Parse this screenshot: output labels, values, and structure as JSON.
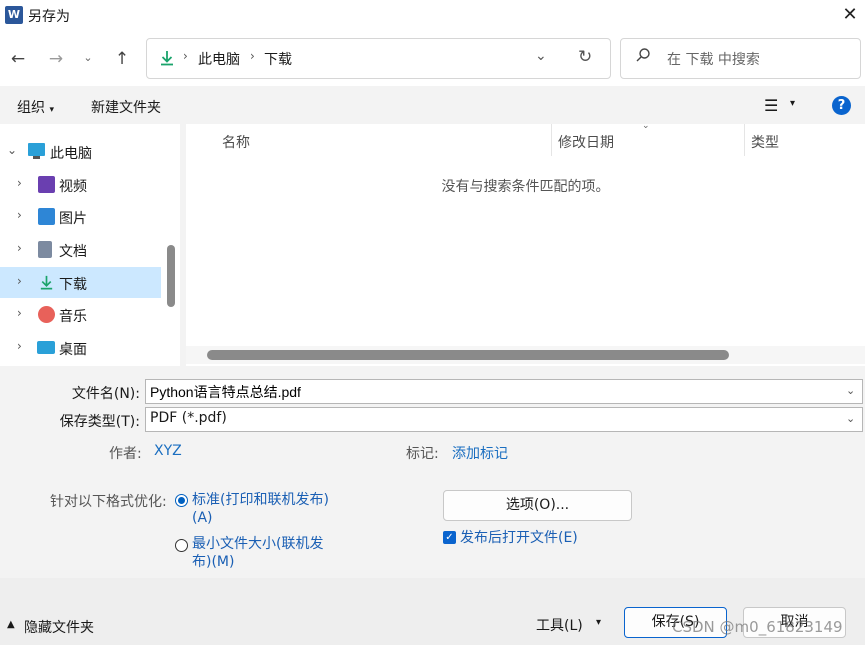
{
  "window": {
    "title": "另存为",
    "app_icon": "W"
  },
  "nav": {
    "breadcrumb": [
      "此电脑",
      "下载"
    ],
    "search_placeholder": "在 下载 中搜索"
  },
  "toolbar": {
    "organize": "组织",
    "new_folder": "新建文件夹"
  },
  "sidebar": {
    "items": [
      {
        "label": "此电脑",
        "icon": "pc-icon"
      },
      {
        "label": "视频",
        "icon": "video-icon"
      },
      {
        "label": "图片",
        "icon": "picture-icon"
      },
      {
        "label": "文档",
        "icon": "document-icon"
      },
      {
        "label": "下载",
        "icon": "download-icon",
        "selected": true
      },
      {
        "label": "音乐",
        "icon": "music-icon"
      },
      {
        "label": "桌面",
        "icon": "desktop-icon"
      }
    ]
  },
  "filelist": {
    "columns": [
      "名称",
      "修改日期",
      "类型"
    ],
    "empty_message": "没有与搜索条件匹配的项。"
  },
  "form": {
    "filename_label": "文件名(N):",
    "filename_value": "Python语言特点总结.pdf",
    "filetype_label": "保存类型(T):",
    "filetype_value": "PDF (*.pdf)",
    "author_label": "作者:",
    "author_value": "XYZ",
    "tags_label": "标记:",
    "tags_value": "添加标记",
    "optimize_label": "针对以下格式优化:",
    "optimize_option_1_line1": "标准(打印和联机发布)",
    "optimize_option_1_line2": "(A)",
    "optimize_option_2_line1": "最小文件大小(联机发",
    "optimize_option_2_line2": "布)(M)",
    "options_button": "选项(O)...",
    "open_after_publish": "发布后打开文件(E)"
  },
  "footer": {
    "hide_folders": "隐藏文件夹",
    "tools": "工具(L)",
    "save": "保存(S)",
    "cancel": "取消"
  },
  "watermark": "CSDN @m0_61823149",
  "colors": {
    "accent": "#0a64ce",
    "selected_row": "#cce8ff",
    "link": "#1a6ec0"
  }
}
